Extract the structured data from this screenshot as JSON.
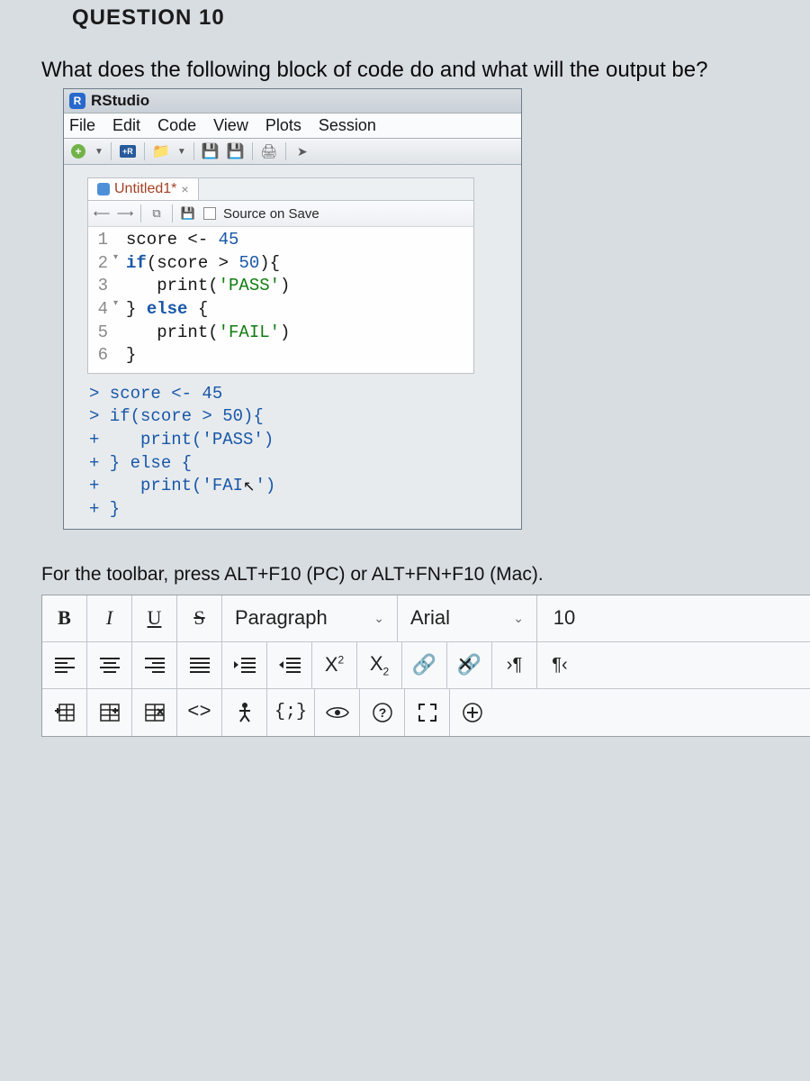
{
  "question": {
    "heading": "QUESTION 10",
    "prompt": "What does the following block of code do and what will the output be?"
  },
  "rstudio": {
    "title": "RStudio",
    "menu": {
      "file": "File",
      "edit": "Edit",
      "code": "Code",
      "view": "View",
      "plots": "Plots",
      "session": "Session"
    },
    "tab_name": "Untitled1*",
    "source_on_save": "Source on Save",
    "code_lines": {
      "l1_num": "1",
      "l2_num": "2",
      "l3_num": "3",
      "l4_num": "4",
      "l5_num": "5",
      "l6_num": "6",
      "l1_a": "score ",
      "l1_op": "<-",
      "l1_b": " ",
      "l1_val": "45",
      "l2_a": "if",
      "l2_b": "(score ",
      "l2_op": ">",
      "l2_c": " ",
      "l2_val": "50",
      "l2_d": "){",
      "l3_a": "   print(",
      "l3_str": "'PASS'",
      "l3_b": ")",
      "l4_a": "} ",
      "l4_kw": "else",
      "l4_b": " {",
      "l5_a": "   print(",
      "l5_str": "'FAIL'",
      "l5_b": ")",
      "l6_a": "}"
    },
    "console": {
      "c1": "> score <- 45",
      "c2": "> if(score > 50){",
      "c3": "+    print('PASS')",
      "c4": "+ } else {",
      "c5_a": "+    print('FAI",
      "c5_b": "')",
      "c6": "+ }"
    }
  },
  "rte": {
    "hint": "For the toolbar, press ALT+F10 (PC) or ALT+FN+F10 (Mac).",
    "bold": "B",
    "italic": "I",
    "underline": "U",
    "strike": "S",
    "para": "Paragraph",
    "font": "Arial",
    "size": "10",
    "superscript": "X",
    "subscript": "X",
    "codeview": "<>",
    "css": "{;}"
  }
}
